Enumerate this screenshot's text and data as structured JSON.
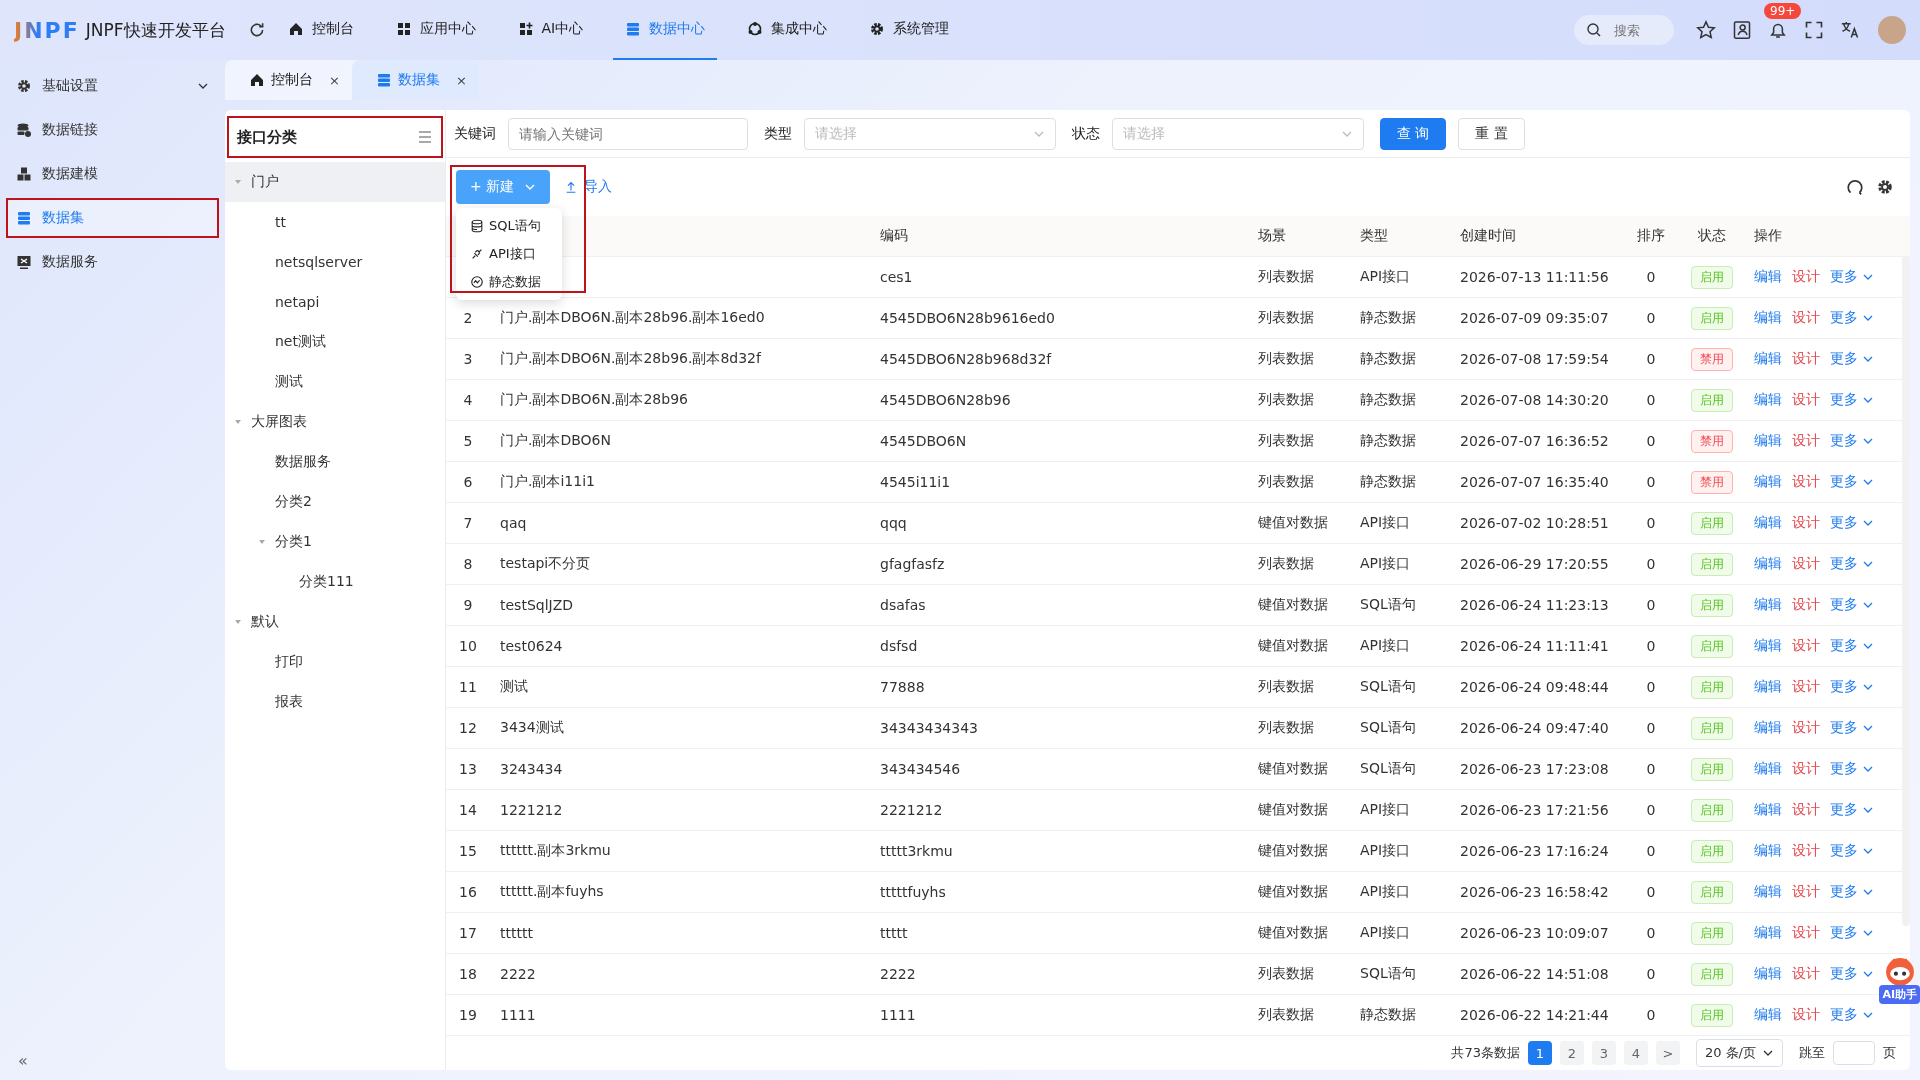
{
  "header": {
    "logo": "JNPF",
    "title": "JNPF快速开发平台",
    "nav": [
      {
        "label": "控制台",
        "kind": "home",
        "selected": false
      },
      {
        "label": "应用中心",
        "kind": "grid",
        "selected": false
      },
      {
        "label": "AI中心",
        "kind": "gridplus",
        "selected": false
      },
      {
        "label": "数据中心",
        "kind": "db",
        "selected": true
      },
      {
        "label": "集成中心",
        "kind": "hub",
        "selected": false
      },
      {
        "label": "系统管理",
        "kind": "gear",
        "selected": false
      }
    ],
    "search": {
      "placeholder": "搜索"
    },
    "notification_badge": "99+"
  },
  "sidebar": {
    "items": [
      {
        "label": "基础设置",
        "kind": "gear",
        "selected": false,
        "expanded": false,
        "highlighted": false
      },
      {
        "label": "数据链接",
        "kind": "link",
        "selected": false,
        "highlighted": false
      },
      {
        "label": "数据建模",
        "kind": "cubes",
        "selected": false,
        "highlighted": false
      },
      {
        "label": "数据集",
        "kind": "db",
        "selected": true,
        "highlighted": true
      },
      {
        "label": "数据服务",
        "kind": "service",
        "selected": false,
        "highlighted": false
      }
    ],
    "collapse": "«"
  },
  "tabs": [
    {
      "label": "控制台",
      "kind": "home",
      "selected": false,
      "close": "×"
    },
    {
      "label": "数据集",
      "kind": "db",
      "selected": true,
      "close": "×"
    }
  ],
  "tree": {
    "title": "接口分类",
    "highlighted": true,
    "items": [
      {
        "label": "门户",
        "expanded": true,
        "selected": true,
        "children": [
          {
            "label": "tt",
            "selected": false
          },
          {
            "label": "netsqlserver",
            "selected": false
          },
          {
            "label": "netapi",
            "selected": false
          },
          {
            "label": "net测试",
            "selected": false
          },
          {
            "label": "测试",
            "selected": false
          }
        ]
      },
      {
        "label": "大屏图表",
        "expanded": true,
        "selected": false,
        "children": [
          {
            "label": "数据服务",
            "selected": false
          },
          {
            "label": "分类2",
            "selected": false
          },
          {
            "label": "分类1",
            "expanded": true,
            "selected": false,
            "children": [
              {
                "label": "分类111",
                "selected": false
              }
            ]
          }
        ]
      },
      {
        "label": "默认",
        "expanded": true,
        "selected": false,
        "children": [
          {
            "label": "打印",
            "selected": false
          },
          {
            "label": "报表",
            "selected": false
          }
        ]
      }
    ]
  },
  "filters": {
    "keyword": {
      "label": "关键词",
      "placeholder": "请输入关键词"
    },
    "type": {
      "label": "类型",
      "placeholder": "请选择"
    },
    "status": {
      "label": "状态",
      "placeholder": "请选择"
    },
    "query_button": "查 询",
    "reset_button": "重 置"
  },
  "toolbar": {
    "new_button": {
      "label": "+ 新建",
      "expanded": true,
      "highlighted": true
    },
    "import_link": "导入",
    "new_menu": [
      {
        "label": "SQL语句",
        "kind": "sql"
      },
      {
        "label": "API接口",
        "kind": "api"
      },
      {
        "label": "静态数据",
        "kind": "static"
      }
    ]
  },
  "table": {
    "columns": [
      "编码",
      "场景",
      "类型",
      "创建时间",
      "排序",
      "状态",
      "操作"
    ],
    "rows": [
      {
        "code": "ces1",
        "scene": "列表数据",
        "type": "API接口",
        "created": "2026-07-13 11:11:56",
        "order": "0",
        "status": "启用",
        "enabled": true,
        "actions": [
          "编辑",
          "设计",
          "更多"
        ]
      },
      {
        "index": "2",
        "name": "门户.副本DBO6N.副本28b96.副本16ed0",
        "code": "4545DBO6N28b9616ed0",
        "scene": "列表数据",
        "type": "静态数据",
        "created": "2026-07-09 09:35:07",
        "order": "0",
        "status": "启用",
        "enabled": true,
        "actions": [
          "编辑",
          "设计",
          "更多"
        ]
      },
      {
        "index": "3",
        "name": "门户.副本DBO6N.副本28b96.副本8d32f",
        "code": "4545DBO6N28b968d32f",
        "scene": "列表数据",
        "type": "静态数据",
        "created": "2026-07-08 17:59:54",
        "order": "0",
        "status": "禁用",
        "enabled": false,
        "actions": [
          "编辑",
          "设计",
          "更多"
        ]
      },
      {
        "index": "4",
        "name": "门户.副本DBO6N.副本28b96",
        "code": "4545DBO6N28b96",
        "scene": "列表数据",
        "type": "静态数据",
        "created": "2026-07-08 14:30:20",
        "order": "0",
        "status": "启用",
        "enabled": true,
        "actions": [
          "编辑",
          "设计",
          "更多"
        ]
      },
      {
        "index": "5",
        "name": "门户.副本DBO6N",
        "code": "4545DBO6N",
        "scene": "列表数据",
        "type": "静态数据",
        "created": "2026-07-07 16:36:52",
        "order": "0",
        "status": "禁用",
        "enabled": false,
        "actions": [
          "编辑",
          "设计",
          "更多"
        ]
      },
      {
        "index": "6",
        "name": "门户.副本i11i1",
        "code": "4545i11i1",
        "scene": "列表数据",
        "type": "静态数据",
        "created": "2026-07-07 16:35:40",
        "order": "0",
        "status": "禁用",
        "enabled": false,
        "actions": [
          "编辑",
          "设计",
          "更多"
        ]
      },
      {
        "index": "7",
        "name": "qaq",
        "code": "qqq",
        "scene": "键值对数据",
        "type": "API接口",
        "created": "2026-07-02 10:28:51",
        "order": "0",
        "status": "启用",
        "enabled": true,
        "actions": [
          "编辑",
          "设计",
          "更多"
        ]
      },
      {
        "index": "8",
        "name": "testapi不分页",
        "code": "gfagfasfz",
        "scene": "列表数据",
        "type": "API接口",
        "created": "2026-06-29 17:20:55",
        "order": "0",
        "status": "启用",
        "enabled": true,
        "actions": [
          "编辑",
          "设计",
          "更多"
        ]
      },
      {
        "index": "9",
        "name": "testSqlJZD",
        "code": "dsafas",
        "scene": "键值对数据",
        "type": "SQL语句",
        "created": "2026-06-24 11:23:13",
        "order": "0",
        "status": "启用",
        "enabled": true,
        "actions": [
          "编辑",
          "设计",
          "更多"
        ]
      },
      {
        "index": "10",
        "name": "test0624",
        "code": "dsfsd",
        "scene": "键值对数据",
        "type": "API接口",
        "created": "2026-06-24 11:11:41",
        "order": "0",
        "status": "启用",
        "enabled": true,
        "actions": [
          "编辑",
          "设计",
          "更多"
        ]
      },
      {
        "index": "11",
        "name": "测试",
        "code": "77888",
        "scene": "列表数据",
        "type": "SQL语句",
        "created": "2026-06-24 09:48:44",
        "order": "0",
        "status": "启用",
        "enabled": true,
        "actions": [
          "编辑",
          "设计",
          "更多"
        ]
      },
      {
        "index": "12",
        "name": "3434测试",
        "code": "34343434343",
        "scene": "列表数据",
        "type": "SQL语句",
        "created": "2026-06-24 09:47:40",
        "order": "0",
        "status": "启用",
        "enabled": true,
        "actions": [
          "编辑",
          "设计",
          "更多"
        ]
      },
      {
        "index": "13",
        "name": "3243434",
        "code": "343434546",
        "scene": "键值对数据",
        "type": "SQL语句",
        "created": "2026-06-23 17:23:08",
        "order": "0",
        "status": "启用",
        "enabled": true,
        "actions": [
          "编辑",
          "设计",
          "更多"
        ]
      },
      {
        "index": "14",
        "name": "1221212",
        "code": "2221212",
        "scene": "键值对数据",
        "type": "API接口",
        "created": "2026-06-23 17:21:56",
        "order": "0",
        "status": "启用",
        "enabled": true,
        "actions": [
          "编辑",
          "设计",
          "更多"
        ]
      },
      {
        "index": "15",
        "name": "tttttt.副本3rkmu",
        "code": "ttttt3rkmu",
        "scene": "键值对数据",
        "type": "API接口",
        "created": "2026-06-23 17:16:24",
        "order": "0",
        "status": "启用",
        "enabled": true,
        "actions": [
          "编辑",
          "设计",
          "更多"
        ]
      },
      {
        "index": "16",
        "name": "tttttt.副本fuyhs",
        "code": "tttttfuyhs",
        "scene": "键值对数据",
        "type": "API接口",
        "created": "2026-06-23 16:58:42",
        "order": "0",
        "status": "启用",
        "enabled": true,
        "actions": [
          "编辑",
          "设计",
          "更多"
        ]
      },
      {
        "index": "17",
        "name": "tttttt",
        "code": "ttttt",
        "scene": "键值对数据",
        "type": "API接口",
        "created": "2026-06-23 10:09:07",
        "order": "0",
        "status": "启用",
        "enabled": true,
        "actions": [
          "编辑",
          "设计",
          "更多"
        ]
      },
      {
        "index": "18",
        "name": "2222",
        "code": "2222",
        "scene": "列表数据",
        "type": "SQL语句",
        "created": "2026-06-22 14:51:08",
        "order": "0",
        "status": "启用",
        "enabled": true,
        "actions": [
          "编辑",
          "设计",
          "更多"
        ]
      },
      {
        "index": "19",
        "name": "1111",
        "code": "1111",
        "scene": "列表数据",
        "type": "静态数据",
        "created": "2026-06-22 14:21:44",
        "order": "0",
        "status": "启用",
        "enabled": true,
        "actions": [
          "编辑",
          "设计",
          "更多"
        ]
      }
    ]
  },
  "pagination": {
    "total": "共73条数据",
    "pages": [
      {
        "label": "1",
        "selected": true
      },
      {
        "label": "2",
        "selected": false
      },
      {
        "label": "3",
        "selected": false
      },
      {
        "label": "4",
        "selected": false
      }
    ],
    "next": ">",
    "page_size": "20 条/页",
    "jump_label": "跳至",
    "page_unit": "页"
  },
  "assistant": {
    "label": "AI助手"
  }
}
